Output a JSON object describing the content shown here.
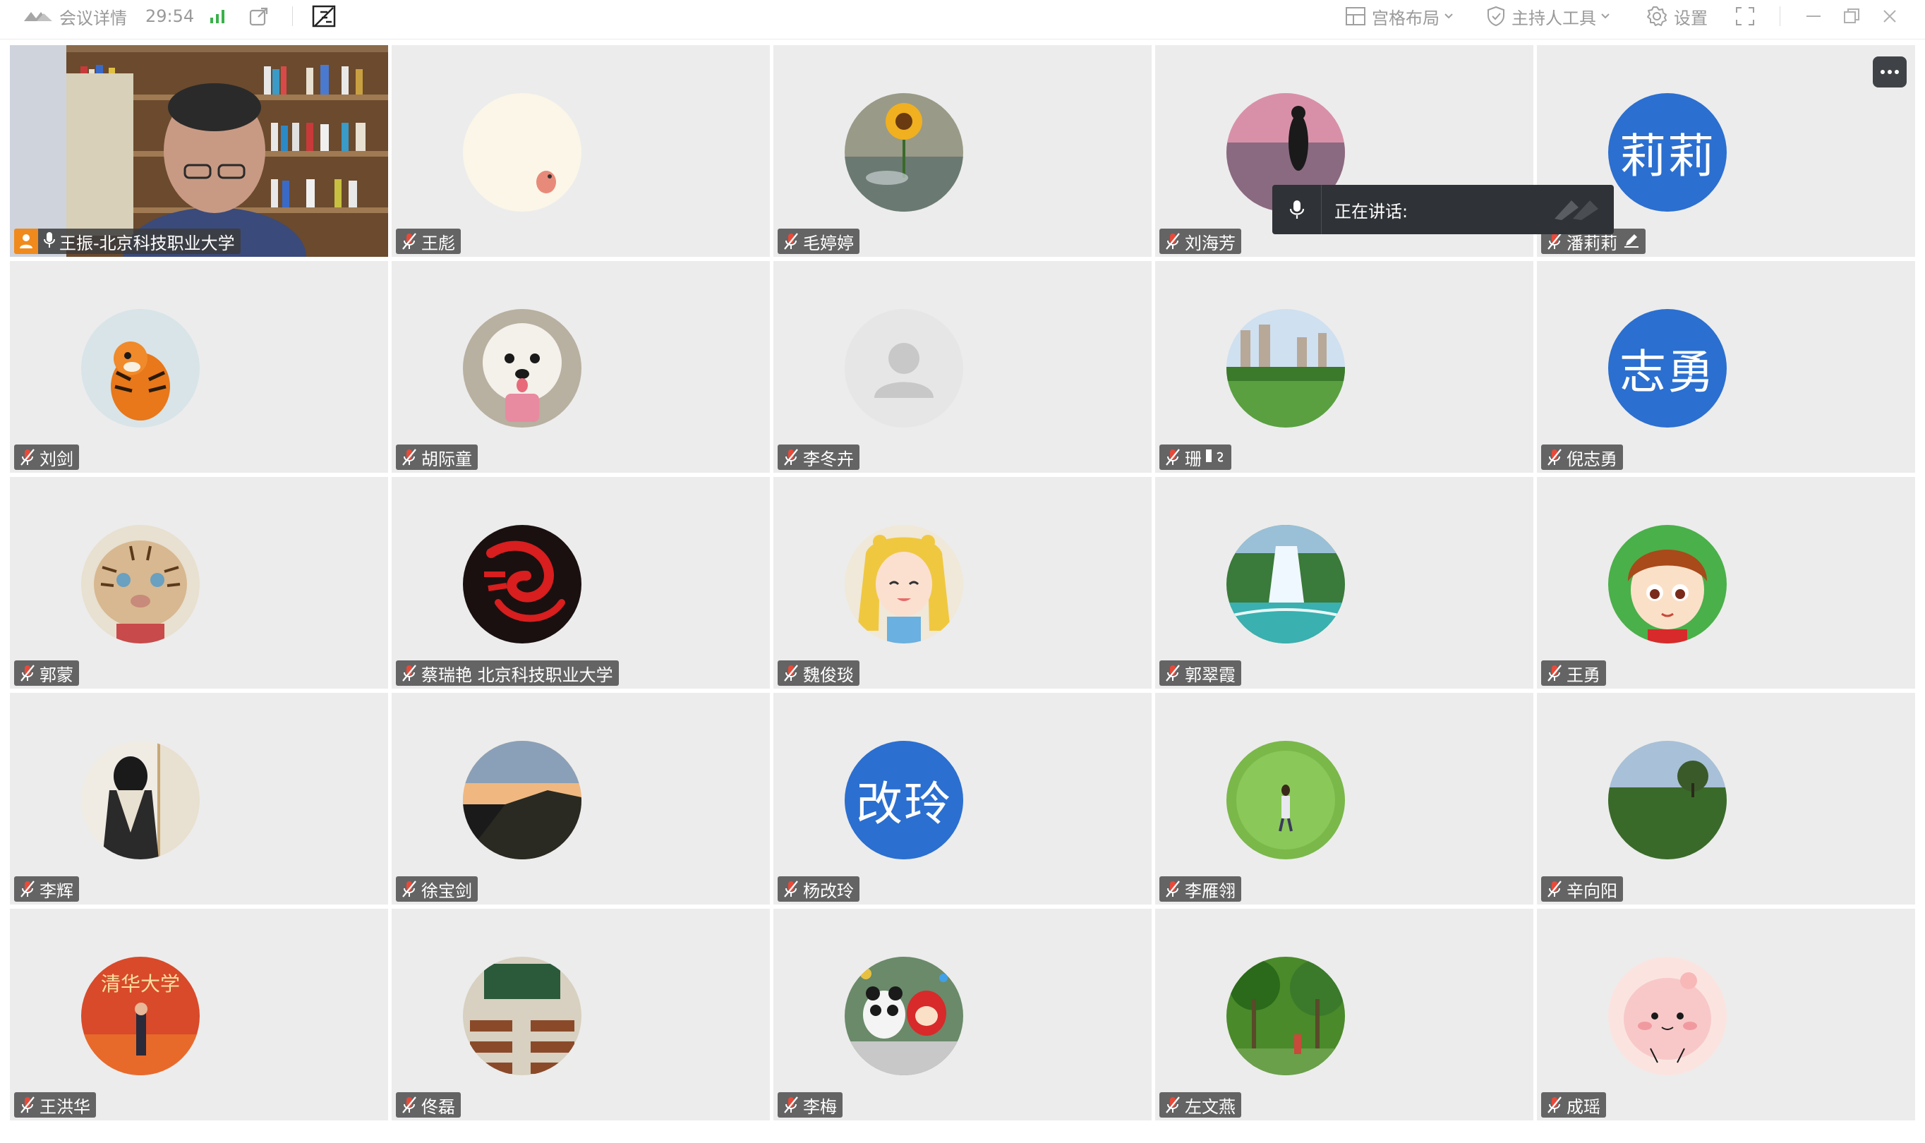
{
  "topbar": {
    "meeting_details": "会议详情",
    "timer": "29:54",
    "layout_label": "宫格布局",
    "host_tools_label": "主持人工具",
    "settings_label": "设置"
  },
  "speaking_indicator": {
    "label": "正在讲话:"
  },
  "participants": [
    {
      "name": "王振-北京科技职业大学",
      "host": true,
      "video": true
    },
    {
      "name": "王彪"
    },
    {
      "name": "毛婷婷"
    },
    {
      "name": "刘海芳"
    },
    {
      "name": "潘莉莉",
      "avatar_text": "莉莉",
      "editing": true
    },
    {
      "name": "刘剑"
    },
    {
      "name": "胡际童"
    },
    {
      "name": "李冬卉"
    },
    {
      "name": "珊"
    },
    {
      "name": "倪志勇",
      "avatar_text": "志勇"
    },
    {
      "name": "郭蒙"
    },
    {
      "name": "蔡瑞艳 北京科技职业大学"
    },
    {
      "name": "魏俊琰"
    },
    {
      "name": "郭翠霞"
    },
    {
      "name": "王勇"
    },
    {
      "name": "李辉"
    },
    {
      "name": "徐宝剑"
    },
    {
      "name": "杨改玲",
      "avatar_text": "改玲"
    },
    {
      "name": "李雁翎"
    },
    {
      "name": "辛向阳"
    },
    {
      "name": "王洪华",
      "avatar_text": "清华大学"
    },
    {
      "name": "佟磊"
    },
    {
      "name": "李梅"
    },
    {
      "name": "左文燕"
    },
    {
      "name": "成瑶"
    }
  ],
  "colors": {
    "tile_bg": "#ececec",
    "avatar_blue": "#2b6fd0",
    "host_orange": "#f08a1c",
    "nametag_bg": "#464646"
  }
}
